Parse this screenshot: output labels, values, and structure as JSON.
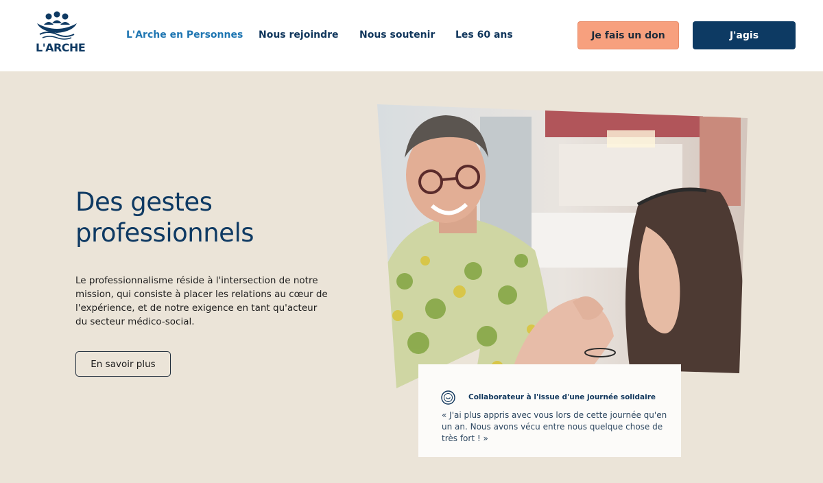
{
  "header": {
    "logo_text": "L'ARCHE",
    "nav": [
      {
        "label": "L'Arche en Personnes",
        "active": true
      },
      {
        "label": "Nous rejoindre",
        "active": false
      },
      {
        "label": "Nous soutenir",
        "active": false
      },
      {
        "label": "Les 60 ans",
        "active": false
      }
    ],
    "donate_label": "Je fais un don",
    "act_label": "J'agis"
  },
  "hero": {
    "title_line1": "Des gestes",
    "title_line2": "professionnels",
    "body": "Le professionnalisme réside à l'intersection de notre mission, qui consiste à placer les relations au cœur de l'expérience, et de notre exigence en tant qu'acteur du secteur médico-social.",
    "more_label": "En savoir plus"
  },
  "testimonial": {
    "author": "Collaborateur à l'issue d'une journée solidaire",
    "text": "« J'ai plus appris avec vous lors de cette journée qu'en un an. Nous avons vécu entre nous quelque chose de très fort ! »"
  },
  "colors": {
    "brand_navy": "#0d3a63",
    "donate_orange": "#f7a07e",
    "nav_active": "#1f76b2",
    "page_bg": "#ebe4d8"
  },
  "icons": [
    "logo-icon",
    "smile-icon"
  ]
}
